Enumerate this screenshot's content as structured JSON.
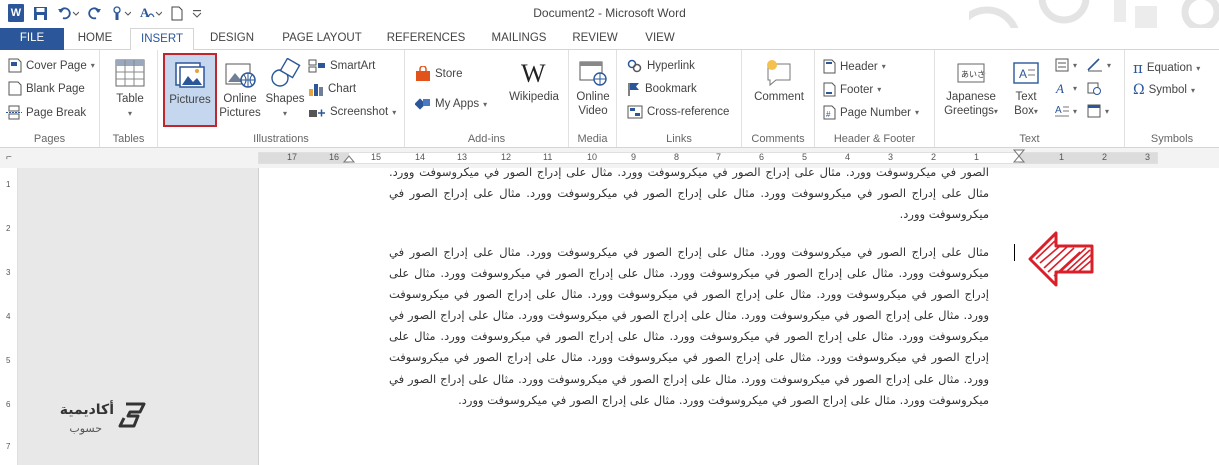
{
  "window": {
    "title": "Document2 - Microsoft Word"
  },
  "tabs": [
    "FILE",
    "HOME",
    "INSERT",
    "DESIGN",
    "PAGE LAYOUT",
    "REFERENCES",
    "MAILINGS",
    "REVIEW",
    "VIEW"
  ],
  "groups": {
    "pages": {
      "label": "Pages",
      "cover_page": "Cover Page",
      "blank_page": "Blank Page",
      "page_break": "Page Break"
    },
    "tables": {
      "label": "Tables",
      "table": "Table"
    },
    "illustrations": {
      "label": "Illustrations",
      "pictures": "Pictures",
      "online_pictures_1": "Online",
      "online_pictures_2": "Pictures",
      "shapes": "Shapes",
      "smartart": "SmartArt",
      "chart": "Chart",
      "screenshot": "Screenshot"
    },
    "addins": {
      "label": "Add-ins",
      "store": "Store",
      "my_apps": "My Apps",
      "wikipedia": "Wikipedia"
    },
    "media": {
      "label": "Media",
      "online_video_1": "Online",
      "online_video_2": "Video"
    },
    "links": {
      "label": "Links",
      "hyperlink": "Hyperlink",
      "bookmark": "Bookmark",
      "cross_reference": "Cross-reference"
    },
    "comments": {
      "label": "Comments",
      "comment": "Comment"
    },
    "header_footer": {
      "label": "Header & Footer",
      "header": "Header",
      "footer": "Footer",
      "page_number": "Page Number"
    },
    "text": {
      "label": "Text",
      "japanese_1": "Japanese",
      "japanese_2": "Greetings",
      "textbox_1": "Text",
      "textbox_2": "Box"
    },
    "symbols": {
      "label": "Symbols",
      "equation": "Equation",
      "symbol": "Symbol"
    }
  },
  "ruler": {
    "numbers": [
      "17",
      "16",
      "15",
      "14",
      "13",
      "12",
      "11",
      "10",
      "9",
      "8",
      "7",
      "6",
      "5",
      "4",
      "3",
      "2",
      "1",
      "1",
      "2",
      "3"
    ]
  },
  "vruler": {
    "numbers": [
      "1",
      "2",
      "3",
      "4",
      "5",
      "6",
      "7"
    ]
  },
  "document": {
    "para1": "الصور في ميكروسوفت وورد. مثال على إدراج الصور في ميكروسوفت وورد. مثال على إدراج الصور في ميكروسوفت وورد. مثال على إدراج الصور في ميكروسوفت وورد. مثال على إدراج الصور في ميكروسوفت وورد. مثال على إدراج الصور في ميكروسوفت وورد.",
    "para2": "مثال على إدراج الصور في ميكروسوفت وورد. مثال على إدراج الصور في ميكروسوفت وورد. مثال على إدراج الصور في ميكروسوفت وورد. مثال على إدراج الصور في ميكروسوفت وورد. مثال على إدراج الصور في ميكروسوفت وورد. مثال على إدراج الصور في ميكروسوفت وورد. مثال على إدراج الصور في ميكروسوفت وورد. مثال على إدراج الصور في ميكروسوفت وورد. مثال على إدراج الصور في ميكروسوفت وورد. مثال على إدراج الصور في ميكروسوفت وورد. مثال على إدراج الصور في ميكروسوفت وورد. مثال على إدراج الصور في ميكروسوفت وورد. مثال على إدراج الصور في ميكروسوفت وورد. مثال على إدراج الصور في ميكروسوفت وورد. مثال على إدراج الصور في ميكروسوفت وورد. مثال على إدراج الصور في ميكروسوفت وورد. مثال على إدراج الصور في ميكروسوفت وورد. مثال على إدراج الصور في ميكروسوفت وورد. مثال على إدراج الصور في ميكروسوفت وورد. مثال على إدراج الصور في ميكروسوفت وورد. مثال على إدراج الصور في ميكروسوفت وورد."
  },
  "watermark": {
    "line1": "أكاديمية",
    "line2": "حسوب"
  },
  "colors": {
    "word_blue": "#2b579a",
    "highlight_red": "#c0262c",
    "arrow_red": "#d9202a"
  }
}
